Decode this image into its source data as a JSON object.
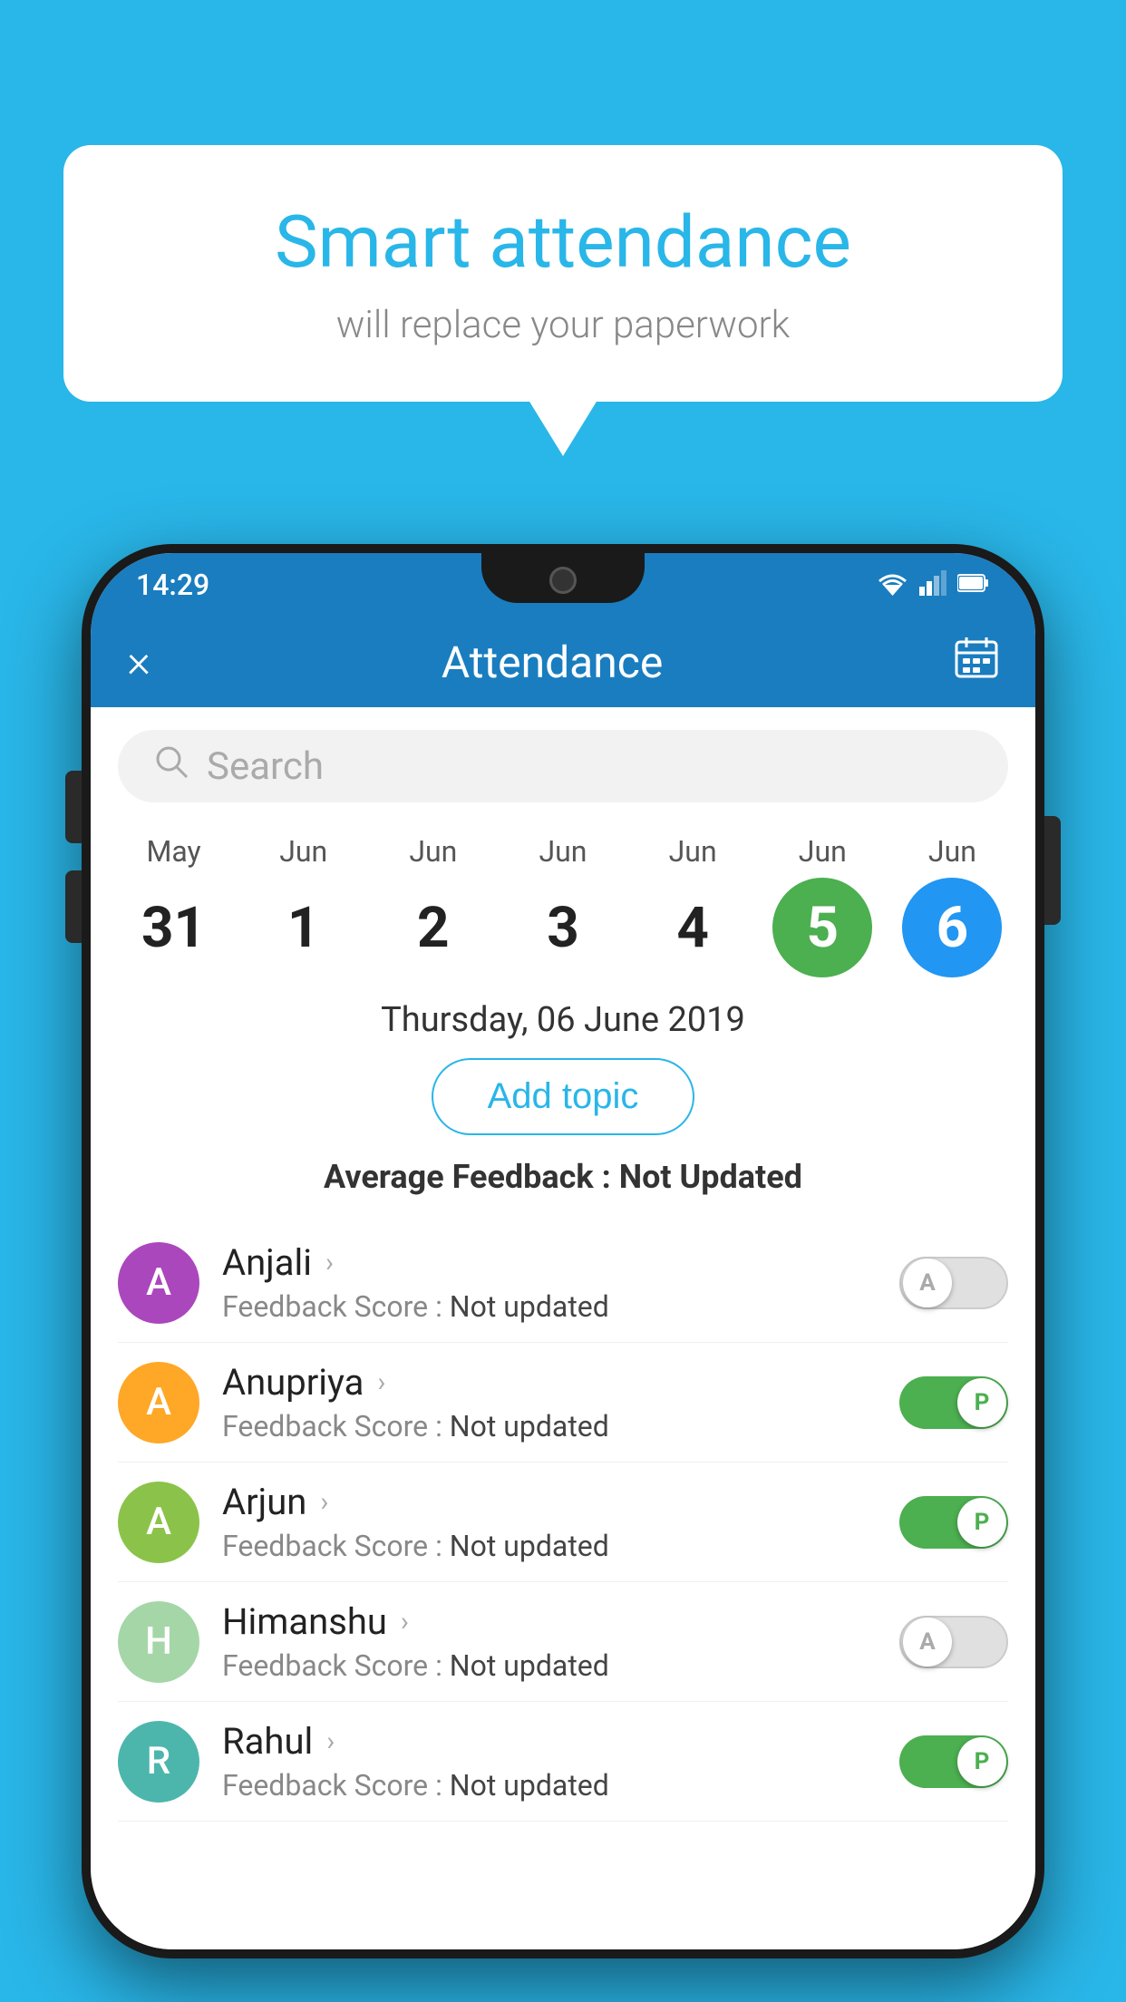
{
  "background_color": "#29b6e8",
  "bubble": {
    "title": "Smart attendance",
    "subtitle": "will replace your paperwork"
  },
  "status_bar": {
    "time": "14:29",
    "wifi_icon": "▼",
    "signal_icon": "▲",
    "battery_icon": "▮"
  },
  "header": {
    "close_label": "×",
    "title": "Attendance",
    "calendar_icon": "📅"
  },
  "search": {
    "placeholder": "Search"
  },
  "calendar": {
    "days": [
      {
        "month": "May",
        "date": "31",
        "style": "normal"
      },
      {
        "month": "Jun",
        "date": "1",
        "style": "normal"
      },
      {
        "month": "Jun",
        "date": "2",
        "style": "normal"
      },
      {
        "month": "Jun",
        "date": "3",
        "style": "normal"
      },
      {
        "month": "Jun",
        "date": "4",
        "style": "normal"
      },
      {
        "month": "Jun",
        "date": "5",
        "style": "green"
      },
      {
        "month": "Jun",
        "date": "6",
        "style": "blue"
      }
    ],
    "selected_date": "Thursday, 06 June 2019"
  },
  "add_topic_label": "Add topic",
  "avg_feedback_label": "Average Feedback :",
  "avg_feedback_value": "Not Updated",
  "students": [
    {
      "name": "Anjali",
      "initial": "A",
      "avatar_color": "#ab47bc",
      "feedback_label": "Feedback Score :",
      "feedback_value": "Not updated",
      "toggle": "off",
      "toggle_letter": "A"
    },
    {
      "name": "Anupriya",
      "initial": "A",
      "avatar_color": "#ffa726",
      "feedback_label": "Feedback Score :",
      "feedback_value": "Not updated",
      "toggle": "on",
      "toggle_letter": "P"
    },
    {
      "name": "Arjun",
      "initial": "A",
      "avatar_color": "#8bc34a",
      "feedback_label": "Feedback Score :",
      "feedback_value": "Not updated",
      "toggle": "on",
      "toggle_letter": "P"
    },
    {
      "name": "Himanshu",
      "initial": "H",
      "avatar_color": "#a5d6a7",
      "feedback_label": "Feedback Score :",
      "feedback_value": "Not updated",
      "toggle": "off",
      "toggle_letter": "A"
    },
    {
      "name": "Rahul",
      "initial": "R",
      "avatar_color": "#4db6ac",
      "feedback_label": "Feedback Score :",
      "feedback_value": "Not updated",
      "toggle": "on",
      "toggle_letter": "P"
    }
  ]
}
